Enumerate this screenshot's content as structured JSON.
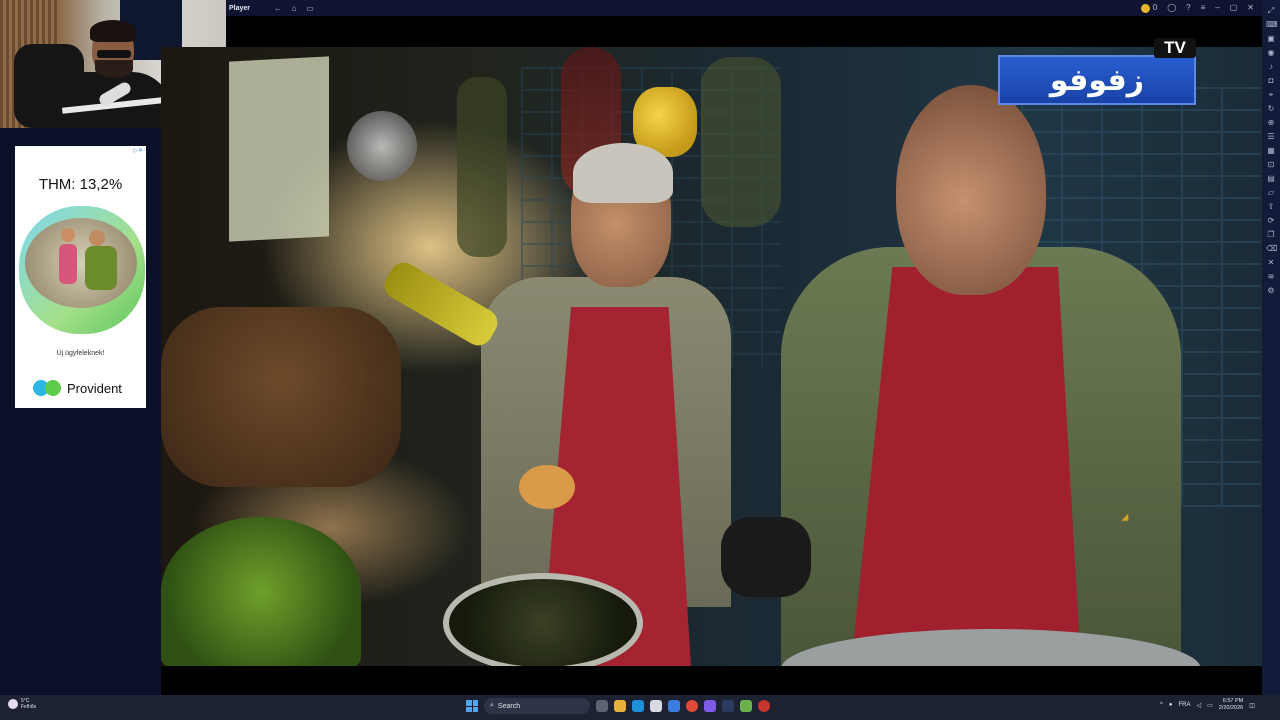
{
  "window": {
    "title": "Player",
    "nav_icons": [
      "back-arrow-icon",
      "home-icon",
      "tabs-icon"
    ],
    "coin_count": "0"
  },
  "channel_logo": {
    "text": "زفوفو",
    "badge": "TV"
  },
  "ad": {
    "close_label": "▷✕",
    "headline": "THM: 13,2%",
    "subtext": "Új ügyfeleknek!",
    "brand": "Provident",
    "colors": {
      "blue": "#2bb7e5",
      "green": "#5ecb4d"
    }
  },
  "taskbar": {
    "weather": {
      "temp": "5°C",
      "condition": "Felhős"
    },
    "search_placeholder": "Search",
    "language": "FRA",
    "clock": {
      "time": "6:57 PM",
      "date": "2/20/2026"
    }
  },
  "colors": {
    "accent": "#1843a8",
    "background": "#0b1029",
    "apron": "#a52432"
  }
}
